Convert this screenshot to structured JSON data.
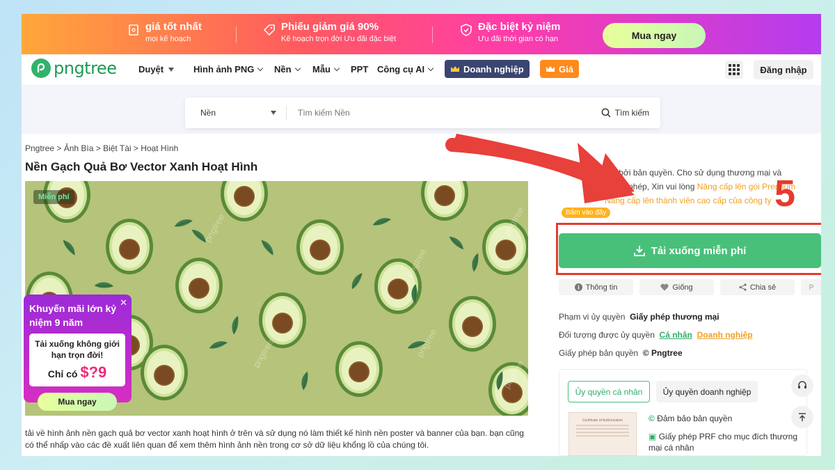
{
  "promo": {
    "items": [
      {
        "title": "giá tốt nhất",
        "subtitle": "mọi kế hoạch"
      },
      {
        "title": "Phiếu giảm giá 90%",
        "subtitle": "Kế hoạch trọn đời Ưu đãi đặc biệt"
      },
      {
        "title": "Đặc biệt kỷ niệm",
        "subtitle": "Ưu đãi thời gian có hạn"
      }
    ],
    "cta": "Mua ngay"
  },
  "nav": {
    "logo": "pngtree",
    "items": [
      "Duyệt",
      "Hình ảnh PNG",
      "Nền",
      "Mẫu",
      "PPT",
      "Công cụ AI"
    ],
    "enterprise": "Doanh nghiệp",
    "price": "Giá",
    "login": "Đăng nhập"
  },
  "search": {
    "category": "Nền",
    "placeholder": "Tìm kiếm Nền",
    "button": "Tìm kiếm"
  },
  "breadcrumb": "Pngtree > Ảnh Bìa > Biệt Tài > Hoạt Hình",
  "title": "Nền Gạch Quả Bơ Vector Xanh Hoạt Hình",
  "preview": {
    "badge": "Miễn phí",
    "watermark": "pngtree"
  },
  "popup": {
    "title": "Khuyến mãi lớn kỷ niệm 9 năm",
    "card_line1": "Tải xuống không giới hạn trọn đời!",
    "card_prefix": "Chỉ có",
    "card_price": "$?9",
    "button": "Mua ngay",
    "close": "✕"
  },
  "description": "tải về hình ảnh nền gạch quả bơ vector xanh hoạt hình ở trên và sử dụng nó làm thiết kế hình nền poster và banner của bạn. bạn cũng có thể nhấp vào các đề xuất liên quan để xem thêm hình ảnh nền trong cơ sở dữ liệu khổng lồ của chúng tôi.",
  "copyright": {
    "line1": "được bảo vệ bởi bản quyền. Cho sử dụng thương mại và",
    "line2a": "phép, Xin vui lòng",
    "line2b": "Nâng cấp lên gói Premium",
    "line3": "Nâng cấp lên thành viên cao cấp của công ty",
    "tap": "Bấm vào đây"
  },
  "annotation": {
    "step": "5"
  },
  "download": {
    "label": "Tải xuống miễn phí"
  },
  "actions": [
    {
      "label": "Thông tin",
      "icon": "info-icon"
    },
    {
      "label": "Giống",
      "icon": "heart-icon"
    },
    {
      "label": "Chia sẻ",
      "icon": "share-icon"
    },
    {
      "label": "",
      "icon": "pinterest-icon"
    }
  ],
  "license": {
    "scope_label": "Phạm vi ủy quyền",
    "scope_value": "Giấy phép thương mại",
    "target_label": "Đối tượng được ủy quyền",
    "target_personal": "Cá nhân",
    "target_business": "Doanh nghiệp",
    "copyright_label": "Giấy phép bản quyền",
    "copyright_value": "Pngtree"
  },
  "license_tabs": {
    "personal": "Ủy quyền cá nhân",
    "business": "Ủy quyền doanh nghiệp"
  },
  "cert": {
    "title": "Certificate of Authorization",
    "item1": "Đảm bảo bản quyền",
    "item2": "Giấy phép PRF cho mục đích thương mại cá nhân"
  },
  "colors": {
    "accent": "#49c07a",
    "annotation": "#e53b2f",
    "orange": "#ffb21f"
  }
}
